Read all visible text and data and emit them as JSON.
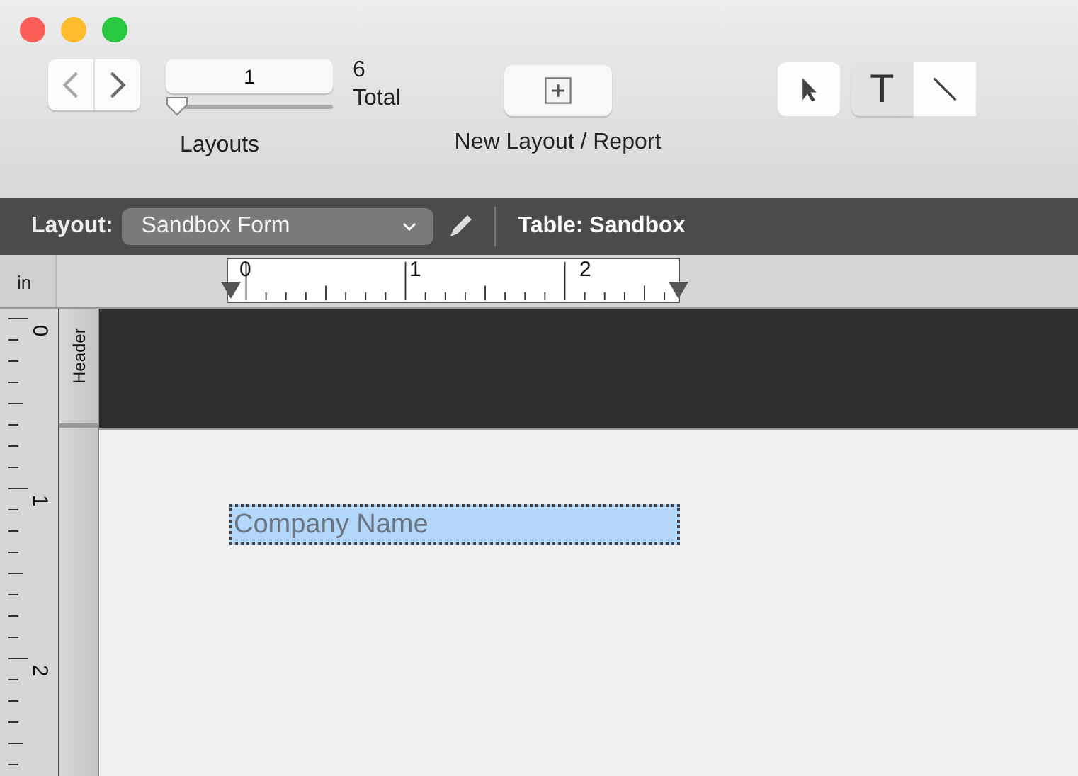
{
  "toolbar": {
    "layouts": {
      "value": "1",
      "level": 0,
      "count": "6",
      "count_label": "Total",
      "label": "Layouts"
    },
    "new_layout": {
      "label": "New Layout / Report"
    },
    "tools": [
      {
        "kind": "arrow",
        "selected": false
      },
      {
        "kind": "text",
        "label": "T",
        "selected": true
      },
      {
        "kind": "line",
        "selected": false
      }
    ]
  },
  "layout_bar": {
    "label": "Layout:",
    "layout": "Sandbox Form",
    "table": "Table: Sandbox"
  },
  "ruler": {
    "unit": "in",
    "marks": [
      "0",
      "1",
      "2"
    ]
  },
  "vertical_ruler": {
    "marks": [
      "0",
      "1",
      "2"
    ]
  },
  "parts": [
    {
      "label": "Header",
      "kind": "header"
    },
    {
      "kind": "body"
    }
  ],
  "fields": [
    {
      "text": "Company Name",
      "selected": true
    }
  ]
}
